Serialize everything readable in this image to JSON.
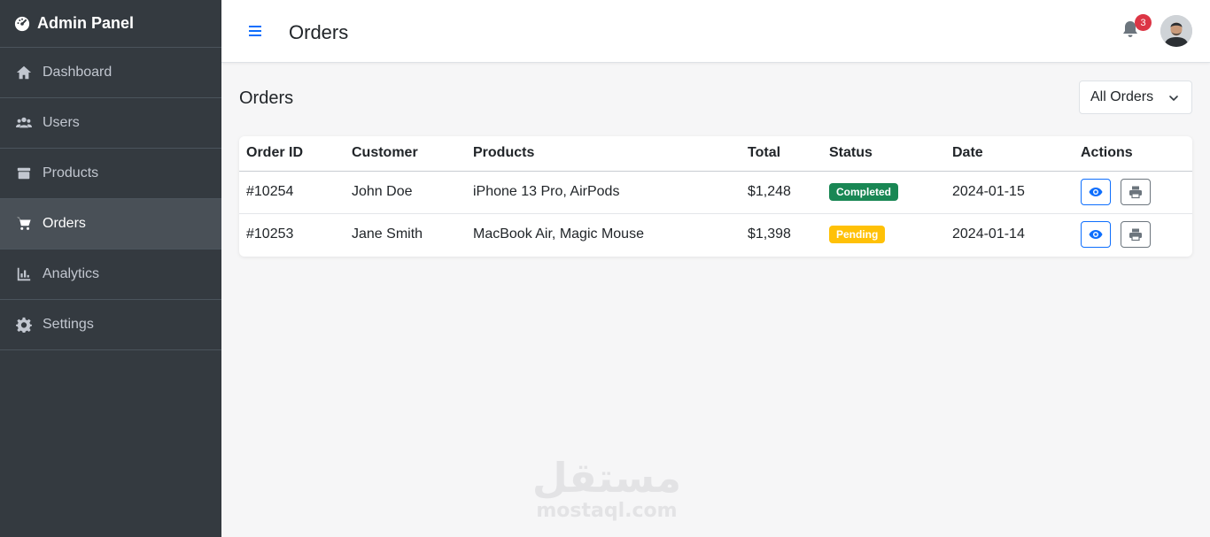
{
  "sidebar": {
    "brand": "Admin Panel",
    "brand_icon": "gauge-icon",
    "items": [
      {
        "label": "Dashboard",
        "icon": "home-icon",
        "active": false
      },
      {
        "label": "Users",
        "icon": "users-icon",
        "active": false
      },
      {
        "label": "Products",
        "icon": "box-icon",
        "active": false
      },
      {
        "label": "Orders",
        "icon": "cart-icon",
        "active": true
      },
      {
        "label": "Analytics",
        "icon": "chart-icon",
        "active": false
      },
      {
        "label": "Settings",
        "icon": "gear-icon",
        "active": false
      }
    ]
  },
  "header": {
    "title": "Orders",
    "notifications_count": "3"
  },
  "main": {
    "section_title": "Orders",
    "filter": {
      "selected": "All Orders"
    },
    "table": {
      "columns": [
        "Order ID",
        "Customer",
        "Products",
        "Total",
        "Status",
        "Date",
        "Actions"
      ],
      "rows": [
        {
          "order_id": "#10254",
          "customer": "John Doe",
          "products": "iPhone 13 Pro, AirPods",
          "total": "$1,248",
          "status": "Completed",
          "status_color": "#198754",
          "date": "2024-01-15"
        },
        {
          "order_id": "#10253",
          "customer": "Jane Smith",
          "products": "MacBook Air, Magic Mouse",
          "total": "$1,398",
          "status": "Pending",
          "status_color": "#ffc107",
          "date": "2024-01-14"
        }
      ]
    }
  },
  "watermark": {
    "arabic": "مستقل",
    "latin": "mostaql.com"
  },
  "colors": {
    "sidebar_bg": "#343a40",
    "sidebar_active": "#495057",
    "primary": "#0d6efd",
    "danger": "#dc3545",
    "success": "#198754",
    "warning": "#ffc107"
  }
}
